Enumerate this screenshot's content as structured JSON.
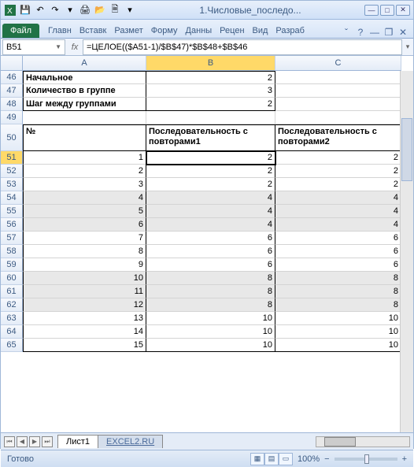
{
  "window": {
    "title": "1.Числовые_последо..."
  },
  "ribbon": {
    "file": "Файл",
    "tabs": [
      "Главн",
      "Вставк",
      "Размет",
      "Форму",
      "Данны",
      "Рецен",
      "Вид",
      "Разраб"
    ]
  },
  "namebox": "B51",
  "formula": "=ЦЕЛОЕ(($A51-1)/$B$47)*$B$48+$B$46",
  "fx": "fx",
  "colheaders": [
    "A",
    "B",
    "C"
  ],
  "params": [
    {
      "row": 46,
      "label": "Начальное",
      "val": "2"
    },
    {
      "row": 47,
      "label": "Количество в группе",
      "val": "3"
    },
    {
      "row": 48,
      "label": "Шаг между группами",
      "val": "2"
    }
  ],
  "header_row": 50,
  "headers": {
    "a": "№",
    "b": "Последовательность с повторами1",
    "c": "Последовательность с повторами2"
  },
  "rows": [
    {
      "r": 51,
      "n": "1",
      "b": "2",
      "c": "2",
      "shade": false,
      "active": true
    },
    {
      "r": 52,
      "n": "2",
      "b": "2",
      "c": "2",
      "shade": false
    },
    {
      "r": 53,
      "n": "3",
      "b": "2",
      "c": "2",
      "shade": false
    },
    {
      "r": 54,
      "n": "4",
      "b": "4",
      "c": "4",
      "shade": true
    },
    {
      "r": 55,
      "n": "5",
      "b": "4",
      "c": "4",
      "shade": true
    },
    {
      "r": 56,
      "n": "6",
      "b": "4",
      "c": "4",
      "shade": true
    },
    {
      "r": 57,
      "n": "7",
      "b": "6",
      "c": "6",
      "shade": false
    },
    {
      "r": 58,
      "n": "8",
      "b": "6",
      "c": "6",
      "shade": false
    },
    {
      "r": 59,
      "n": "9",
      "b": "6",
      "c": "6",
      "shade": false
    },
    {
      "r": 60,
      "n": "10",
      "b": "8",
      "c": "8",
      "shade": true
    },
    {
      "r": 61,
      "n": "11",
      "b": "8",
      "c": "8",
      "shade": true
    },
    {
      "r": 62,
      "n": "12",
      "b": "8",
      "c": "8",
      "shade": true
    },
    {
      "r": 63,
      "n": "13",
      "b": "10",
      "c": "10",
      "shade": false
    },
    {
      "r": 64,
      "n": "14",
      "b": "10",
      "c": "10",
      "shade": false
    },
    {
      "r": 65,
      "n": "15",
      "b": "10",
      "c": "10",
      "shade": false
    }
  ],
  "blank_row": 49,
  "sheets": {
    "active": "Лист1",
    "other": "EXCEL2.RU"
  },
  "status": {
    "ready": "Готово",
    "zoom": "100%"
  }
}
